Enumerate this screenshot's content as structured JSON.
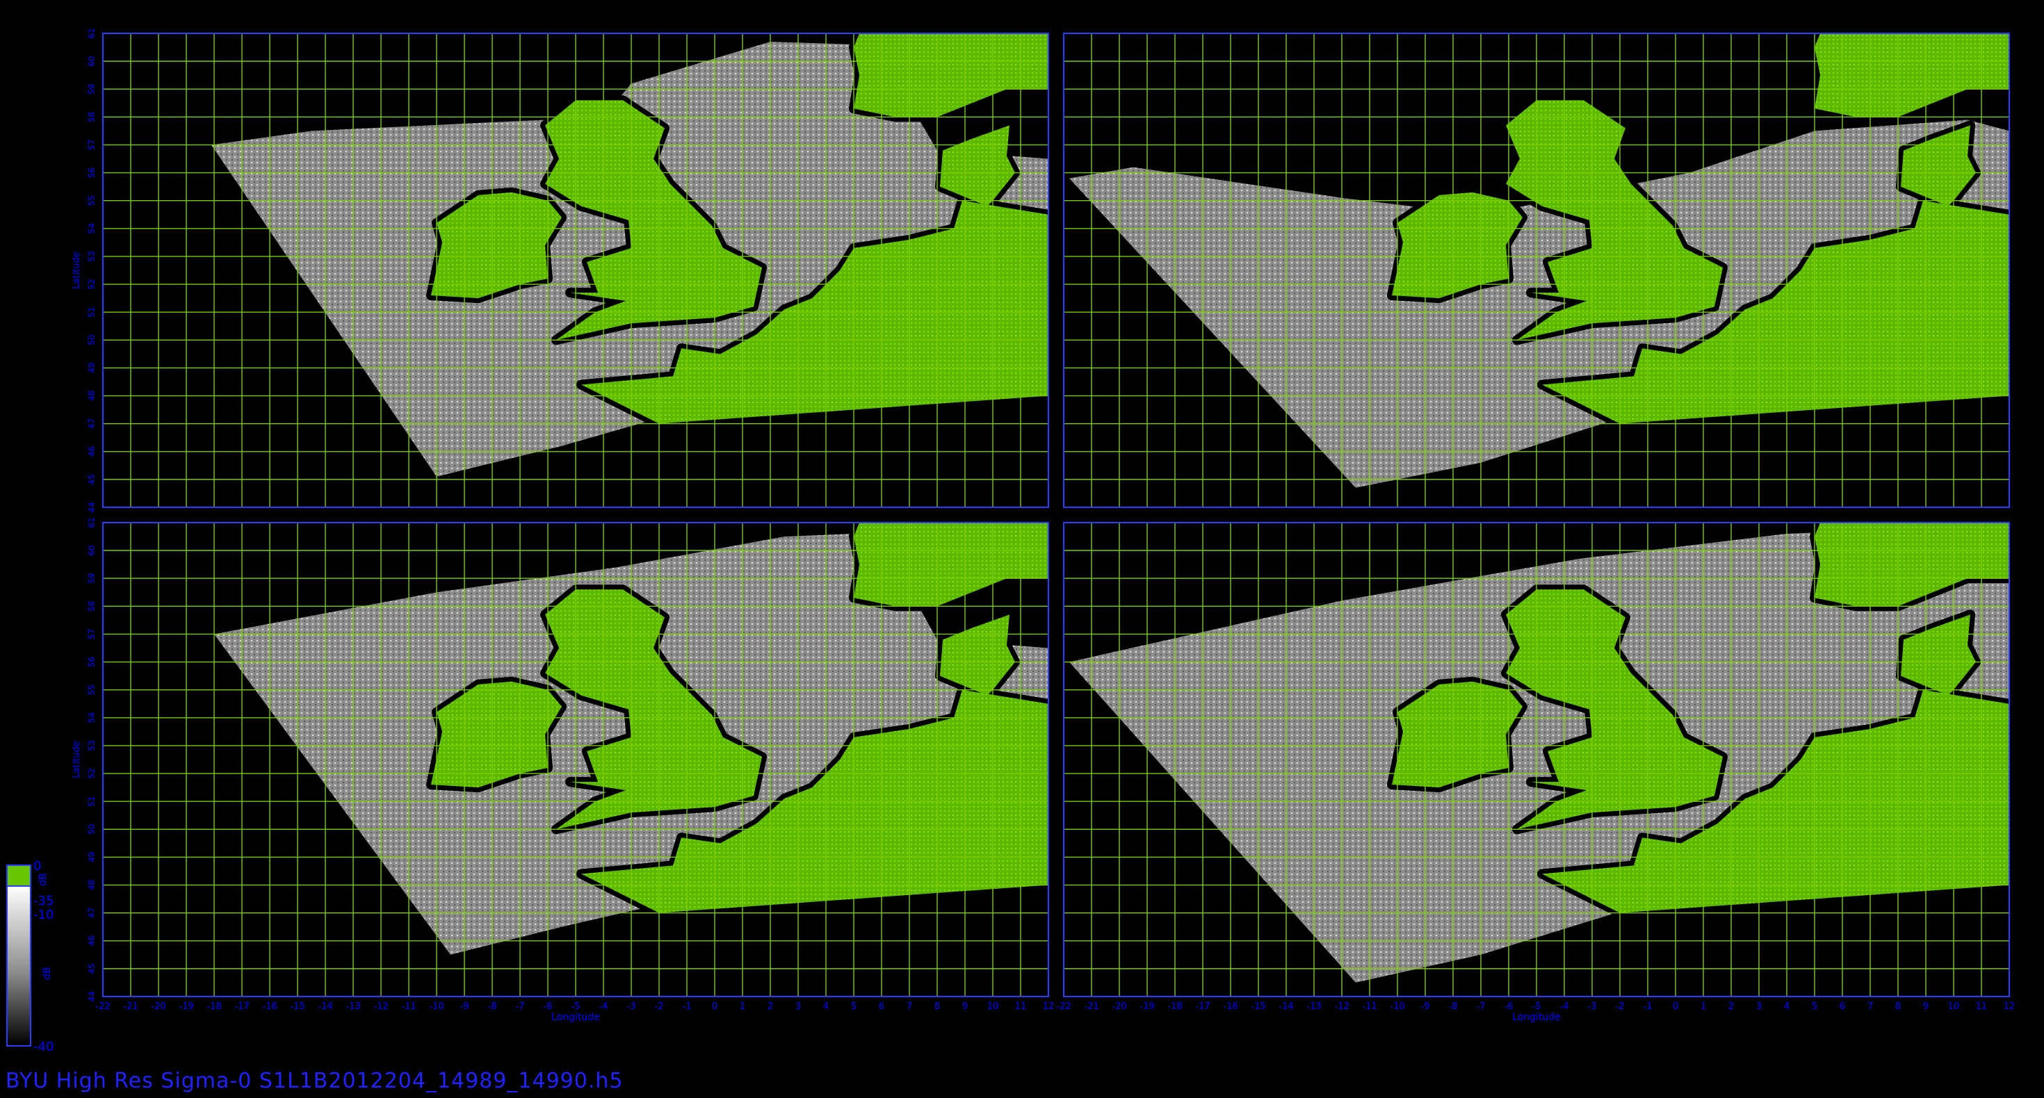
{
  "footer": {
    "caption": "BYU  High  Res  Sigma-0  S1L1B2012204_14989_14990.h5"
  },
  "axes": {
    "xlabel": "Longitude",
    "ylabel": "Latitude",
    "lon_range": [
      -22,
      12
    ],
    "lat_range": [
      44,
      61
    ],
    "lon_ticks_left": [
      "-22",
      "-21",
      "-20",
      "-19",
      "-18",
      "-17",
      "-16",
      "-15",
      "-14",
      "-13",
      "-12",
      "-11",
      "-10",
      "-9",
      "-8",
      "-7",
      "-6",
      "-5",
      "-4",
      "-3",
      "-2",
      "-1",
      "0",
      "1",
      "2",
      "3",
      "4",
      "5",
      "6",
      "7",
      "8",
      "9",
      "10",
      "11",
      "12"
    ],
    "lon_ticks_right": [
      "-22",
      "-21",
      "-20",
      "-19",
      "-18",
      "-17",
      "-16",
      "-15",
      "-14",
      "-13",
      "-12",
      "-11",
      "-10",
      "-9",
      "-8",
      "-7",
      "-6",
      "-5",
      "-4",
      "-3",
      "-2",
      "-1",
      "0",
      "1",
      "2",
      "3",
      "4",
      "5",
      "6",
      "7",
      "8",
      "9",
      "10",
      "11",
      "12"
    ],
    "lat_ticks_top": [
      "44",
      "45",
      "46",
      "47",
      "48",
      "49",
      "50",
      "51",
      "52",
      "53",
      "54",
      "55",
      "56",
      "57",
      "58",
      "59",
      "60",
      "61"
    ],
    "lat_ticks_bottom": [
      "44",
      "45",
      "46",
      "47",
      "48",
      "49",
      "50",
      "51",
      "52",
      "53",
      "54",
      "55",
      "56",
      "57",
      "58",
      "59",
      "60",
      "61"
    ]
  },
  "colorbar": {
    "top_label": "0",
    "mid_label_a": "-35",
    "mid_label_b": "-10",
    "bottom_label": "-40",
    "side_label": "dB",
    "mid_small": "dB"
  },
  "colors": {
    "grid": "#7acc00",
    "land": "#66c400",
    "frame": "#2a3cff",
    "text": "#0000ff"
  },
  "panels": [
    {
      "id": "top-left",
      "swath": [
        [
          -18.1,
          57.0
        ],
        [
          -14.5,
          57.5
        ],
        [
          -4.0,
          58.0
        ],
        [
          -3.0,
          59.2
        ],
        [
          2.0,
          60.7
        ],
        [
          5.0,
          60.6
        ],
        [
          7.0,
          58.5
        ],
        [
          8.0,
          56.8
        ],
        [
          12.0,
          56.5
        ],
        [
          12.0,
          48.8
        ],
        [
          -2.0,
          47.2
        ],
        [
          -5.5,
          46.2
        ],
        [
          -10.0,
          45.1
        ],
        [
          -18.1,
          57.0
        ]
      ]
    },
    {
      "id": "top-right",
      "swath": [
        [
          -21.8,
          55.8
        ],
        [
          -19.5,
          56.2
        ],
        [
          -12.0,
          55.1
        ],
        [
          -7.0,
          54.5
        ],
        [
          0.5,
          56.0
        ],
        [
          5.0,
          57.5
        ],
        [
          10.5,
          57.9
        ],
        [
          12.0,
          57.5
        ],
        [
          12.0,
          48.8
        ],
        [
          -2.0,
          47.2
        ],
        [
          -7.0,
          45.6
        ],
        [
          -11.5,
          44.7
        ],
        [
          -21.8,
          55.8
        ]
      ]
    },
    {
      "id": "bottom-left",
      "swath": [
        [
          -18.0,
          57.0
        ],
        [
          -10.0,
          58.5
        ],
        [
          -3.5,
          59.4
        ],
        [
          2.5,
          60.5
        ],
        [
          5.0,
          60.6
        ],
        [
          7.0,
          58.6
        ],
        [
          8.0,
          56.8
        ],
        [
          12.0,
          56.5
        ],
        [
          12.0,
          48.8
        ],
        [
          -2.0,
          47.3
        ],
        [
          -5.5,
          46.5
        ],
        [
          -9.5,
          45.5
        ],
        [
          -18.0,
          57.0
        ]
      ]
    },
    {
      "id": "bottom-right",
      "swath": [
        [
          -21.8,
          56.0
        ],
        [
          -12.0,
          58.2
        ],
        [
          -3.5,
          59.7
        ],
        [
          4.0,
          60.6
        ],
        [
          12.0,
          60.9
        ],
        [
          12.0,
          48.9
        ],
        [
          -1.5,
          47.2
        ],
        [
          -7.0,
          45.5
        ],
        [
          -11.5,
          44.5
        ],
        [
          -21.8,
          56.0
        ]
      ]
    }
  ]
}
